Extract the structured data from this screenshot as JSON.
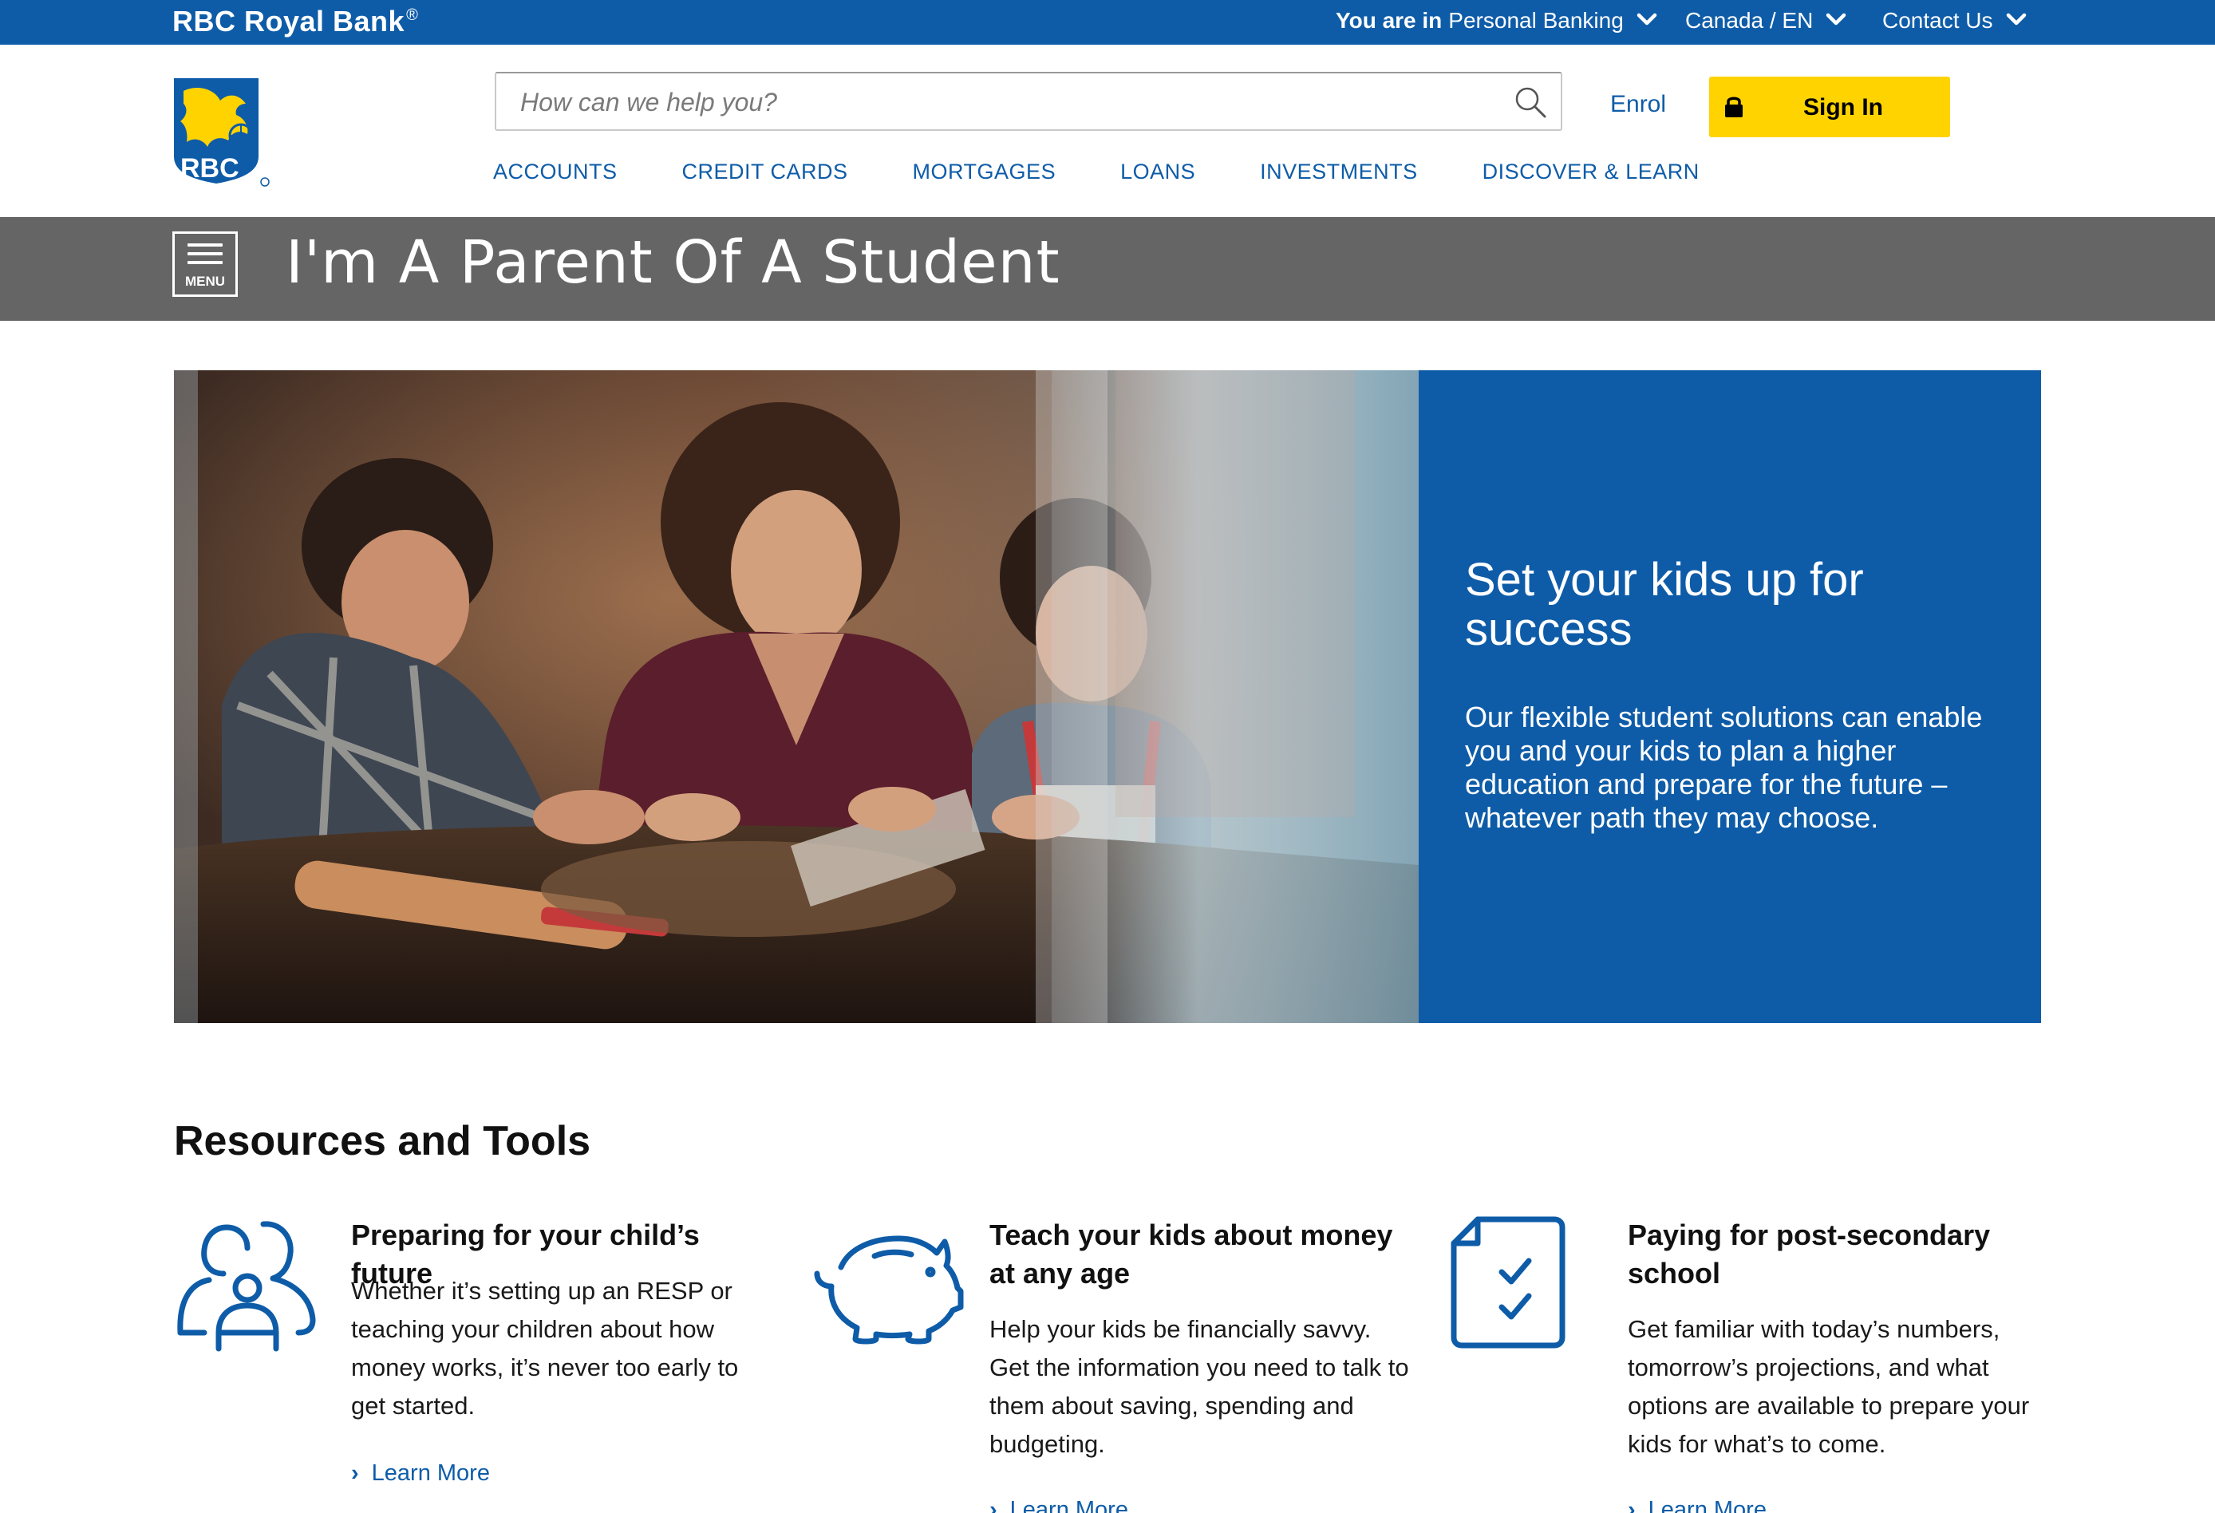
{
  "topbar": {
    "brand": "RBC Royal Bank",
    "brand_mark": "®",
    "you_are_in": "You are in",
    "segment": "Personal Banking",
    "country": "Canada / EN",
    "contact": "Contact Us"
  },
  "header": {
    "logo_text": "RBC",
    "search_placeholder": "How can we help you?",
    "enrol": "Enrol",
    "sign_in": "Sign In"
  },
  "nav": {
    "items": [
      {
        "label": "ACCOUNTS"
      },
      {
        "label": "CREDIT CARDS"
      },
      {
        "label": "MORTGAGES"
      },
      {
        "label": "LOANS"
      },
      {
        "label": "INVESTMENTS"
      },
      {
        "label": "DISCOVER & LEARN"
      }
    ]
  },
  "band": {
    "menu_label": "MENU",
    "title": "I'm A Parent Of A Student"
  },
  "hero": {
    "heading": "Set your kids up for success",
    "body": "Our flexible student solutions can enable you and your kids to plan a higher education and prepare for the future – whatever path they may choose."
  },
  "resources": {
    "title": "Resources and Tools",
    "cards": [
      {
        "icon": "family-icon",
        "title": "Preparing for your child’s future",
        "body": "Whether it’s setting up an RESP or teaching your children about how money works, it’s never too early to get started.",
        "link": "Learn More"
      },
      {
        "icon": "piggy-bank-icon",
        "title": "Teach your kids about money at any age",
        "body": "Help your kids be financially savvy. Get the information you need to talk to them about saving, spending and budgeting.",
        "link": "Learn More"
      },
      {
        "icon": "checklist-icon",
        "title": "Paying for post-secondary school",
        "body": "Get familiar with today’s numbers, tomorrow’s projections, and what options are available to prepare your kids for what’s to come.",
        "link": "Learn More"
      }
    ]
  },
  "colors": {
    "brand_blue": "#0e5ca8",
    "signin_yellow": "#ffd300",
    "band_gray": "#656565"
  }
}
